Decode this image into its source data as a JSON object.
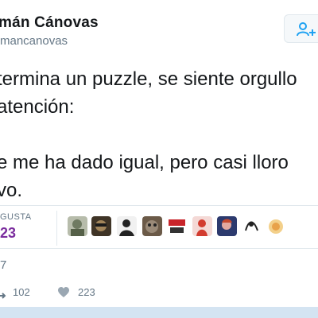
{
  "tweet": {
    "display_name": "mán Cánovas",
    "username": "mancanovas",
    "text_lines": [
      "termina un puzzle, se siente orgullo",
      "atención:",
      "e me ha dado igual, pero casi lloro",
      "vo."
    ],
    "likes_label": "GUSTA",
    "likes_count": "23",
    "timestamp": "7",
    "retweets": "102",
    "likes": "223"
  },
  "colors": {
    "accent": "#1da1f2",
    "likes_count": "#7b2d9e",
    "muted": "#657786",
    "bottom_band": "#d4e4f2"
  },
  "icons": {
    "follow": "follow-user-icon",
    "retweet": "retweet-icon",
    "like": "heart-icon"
  },
  "likers": [
    {
      "name": "liker-avatar-1",
      "color": "#9aa08e"
    },
    {
      "name": "liker-avatar-2",
      "color": "#6b5a3c"
    },
    {
      "name": "liker-avatar-3",
      "color": "#2e2e2e"
    },
    {
      "name": "liker-avatar-4",
      "color": "#5c4a3a"
    },
    {
      "name": "liker-avatar-5",
      "color": "#c8242a"
    },
    {
      "name": "liker-avatar-6",
      "color": "#d23b2f"
    },
    {
      "name": "liker-avatar-7",
      "color": "#3a4c8a"
    },
    {
      "name": "liker-avatar-8",
      "color": "#ffffff"
    },
    {
      "name": "liker-avatar-9",
      "color": "#f3d08a"
    }
  ]
}
